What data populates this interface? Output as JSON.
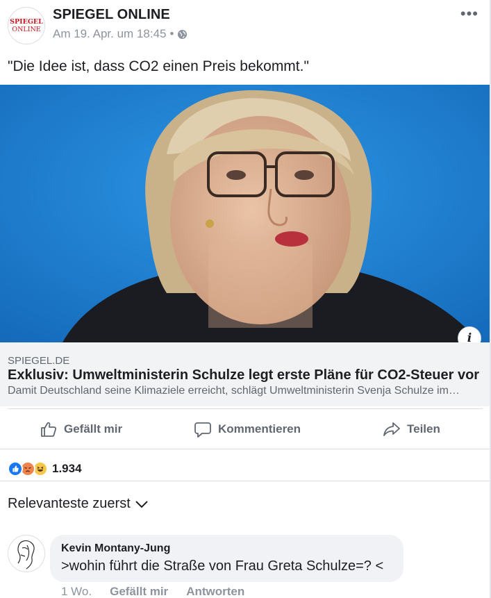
{
  "post": {
    "page_name": "SPIEGEL ONLINE",
    "logo_text_top": "SPIEGEL",
    "logo_text_bottom": "ONLINE",
    "timestamp": "Am 19. Apr. um 18:45",
    "separator": "•",
    "privacy_icon": "globe-icon",
    "more_icon": "more-options-icon",
    "text": "\"Die Idee ist, dass CO2 einen Preis bekommt.\""
  },
  "link": {
    "domain": "SPIEGEL.DE",
    "title": "Exklusiv: Umweltministerin Schulze legt erste Pläne für CO2-Steuer vor",
    "description": "Damit Deutschland seine Klimaziele erreicht, schlägt Umweltministerin Svenja Schulze im…",
    "info_icon_glyph": "i"
  },
  "actions": {
    "like": "Gefällt mir",
    "comment": "Kommentieren",
    "share": "Teilen"
  },
  "reactions": {
    "icons": [
      "like-icon",
      "angry-icon",
      "haha-icon"
    ],
    "count": "1.934"
  },
  "sort": {
    "label": "Relevanteste zuerst"
  },
  "comment": {
    "author": "Kevin Montany-Jung",
    "text": ">wohin führt die Straße von Frau Greta Schulze=? <",
    "age": "1 Wo.",
    "like": "Gefällt mir",
    "reply": "Antworten"
  },
  "colors": {
    "brand_red": "#c4161c",
    "like_blue": "#1877f2",
    "angry": "#f0844c",
    "haha": "#f7c64b",
    "image_bg": "#1d7fd2"
  }
}
